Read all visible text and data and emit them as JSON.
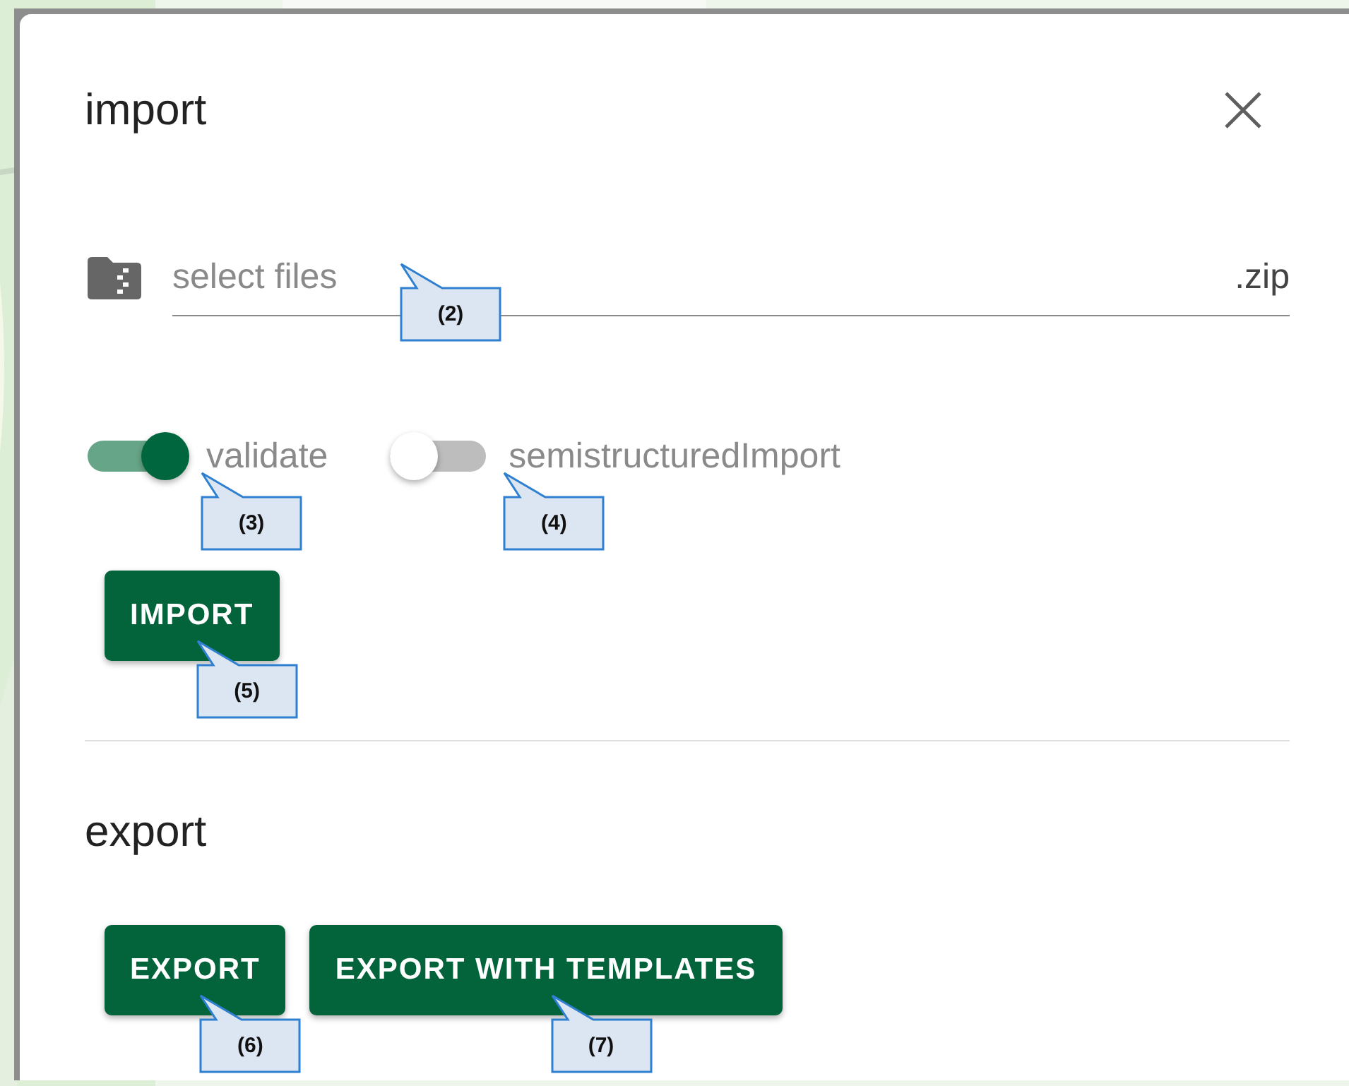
{
  "dialog": {
    "title": "import",
    "file_field": {
      "placeholder": "select files",
      "suffix": ".zip",
      "callout": "(2)"
    },
    "toggles": [
      {
        "label": "validate",
        "on": true,
        "callout": "(3)"
      },
      {
        "label": "semistructuredImport",
        "on": false,
        "callout": "(4)"
      }
    ],
    "import_button": {
      "label": "IMPORT",
      "callout": "(5)"
    },
    "export_section": {
      "title": "export",
      "buttons": [
        {
          "label": "EXPORT",
          "callout": "(6)"
        },
        {
          "label": "EXPORT WITH TEMPLATES",
          "callout": "(7)"
        }
      ]
    }
  }
}
